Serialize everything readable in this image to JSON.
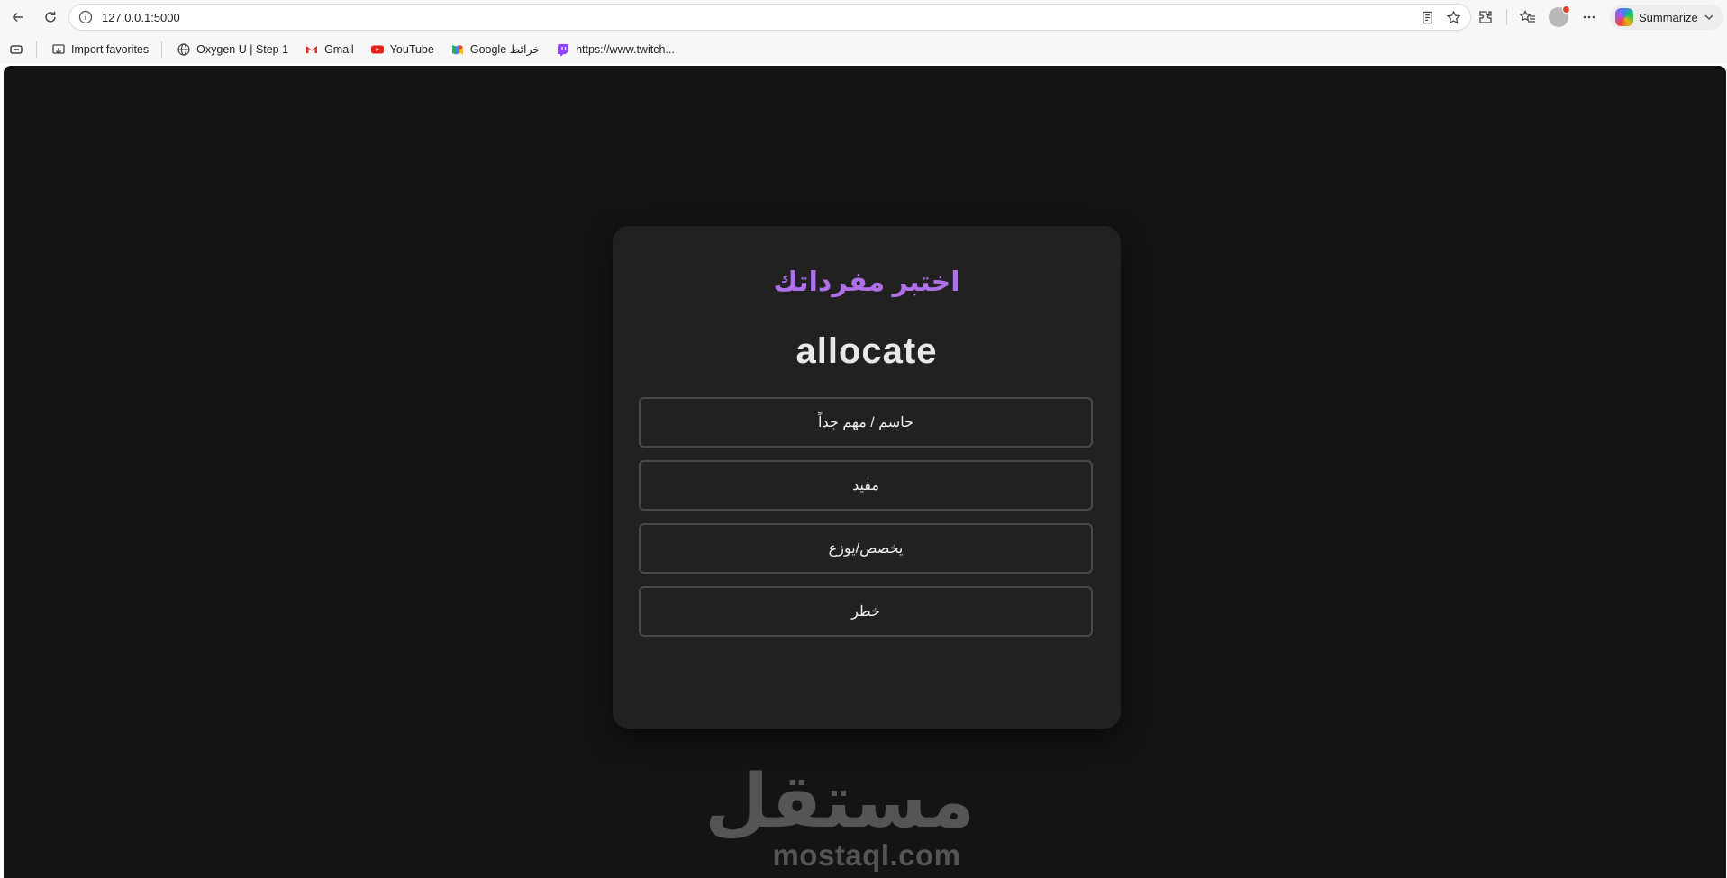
{
  "browser": {
    "url": "127.0.0.1:5000",
    "summarize_label": "Summarize",
    "bookmarks": [
      {
        "label": "Import favorites",
        "icon": "import-favorites-icon"
      },
      {
        "label": "Oxygen U | Step 1",
        "icon": "globe-icon"
      },
      {
        "label": "Gmail",
        "icon": "gmail-icon"
      },
      {
        "label": "YouTube",
        "icon": "youtube-icon"
      },
      {
        "label": "Google خرائط",
        "icon": "google-maps-icon"
      },
      {
        "label": "https://www.twitch...",
        "icon": "twitch-icon"
      }
    ]
  },
  "quiz": {
    "title": "اختبر مفرداتك",
    "word": "allocate",
    "options": [
      "حاسم / مهم جداً",
      "مفيد",
      "يخصص/يوزع",
      "خطر"
    ]
  },
  "watermark": {
    "arabic": "مستقل",
    "latin": "mostaql.com"
  },
  "colors": {
    "title_accent": "#b070e8",
    "page_background": "#141414",
    "card_background": "#212121",
    "option_border": "#4a4a4a"
  }
}
